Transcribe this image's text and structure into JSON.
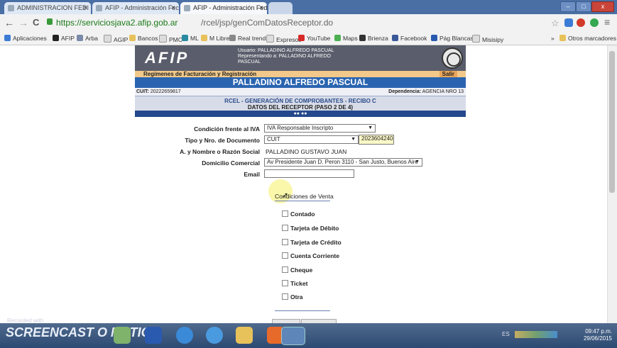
{
  "browser": {
    "tabs": [
      {
        "label": "ADMINISTRACION FEDI"
      },
      {
        "label": "AFIP - Administración Fec"
      },
      {
        "label": "AFIP - Administración Fed"
      }
    ],
    "window_controls": {
      "minimize": "–",
      "maximize": "□",
      "close": "x"
    },
    "nav": {
      "back": "←",
      "forward": "→",
      "reload": "C"
    },
    "url": {
      "domain": "https://serviciosjava2.afip.gob.ar",
      "path": "/rcel/jsp/genComDatosReceptor.do"
    },
    "bookmarks": [
      "Aplicaciones",
      "AFIP",
      "Arba",
      "AGIP",
      "Bancos",
      "PMC",
      "ML",
      "M Libre",
      "Real trends",
      "Expresos",
      "YouTube",
      "Maps",
      "Brienza",
      "Facebook",
      "Pág Blancas",
      "Misisipy"
    ],
    "bookmarks_overflow": "»",
    "other_bookmarks": "Otros marcadores"
  },
  "afip": {
    "logo": "AFIP",
    "usuario": "Usuario: PALLADINO ALFREDO PASCUAL",
    "representando": "Representando a: PALLADINO ALFREDO",
    "pascual": "PASCUAL",
    "regimenes": "Regímenes de Facturación y Registración",
    "salir": "Salir",
    "nombre": "PALLADINO ALFREDO PASCUAL",
    "cuit_label": "CUIT:",
    "cuit_value": "20222659817",
    "dependencia_label": "Dependencia:",
    "dependencia_value": "AGENCIA NRO 13",
    "rcel_title": "RCEL - GENERACIÓN DE COMPROBANTES - RECIBO C",
    "paso_title": "DATOS DEL RECEPTOR (PASO 2 DE 4)",
    "paso_dots": "●● ●●"
  },
  "form": {
    "condicion_label": "Condición frente al IVA",
    "condicion_value": "IVA Responsable Inscripto",
    "tipo_doc_label": "Tipo y Nro. de Documento",
    "tipo_doc_value": "CUIT",
    "nro_doc_value": "20236042406",
    "razon_social_label": "A. y Nombre o Razón Social",
    "razon_social_value": "PALLADINO GUSTAVO JUAN",
    "domicilio_label": "Domicilio Comercial",
    "domicilio_value": "Av Presidente Juan D. Peron 3110 - San Justo, Buenos Aire",
    "email_label": "Email",
    "email_value": "",
    "condiciones_venta_title": "Condiciones de Venta",
    "opciones": [
      "Contado",
      "Tarjeta de Débito",
      "Tarjeta de Crédito",
      "Cuenta Corriente",
      "Cheque",
      "Ticket",
      "Otra"
    ]
  },
  "taskbar": {
    "watermark_small": "Recorded with",
    "watermark": "SCREENCAST O MATIC",
    "lang": "ES",
    "time": "09:47 p.m.",
    "date": "29/06/2015"
  },
  "colors": {
    "tabstrip": "#4a6fa5",
    "afip_header": "#5a5d6b",
    "nombre_bar": "#2a64b0",
    "regimenes_bar": "#f2c98a",
    "step_bar": "#24488c",
    "doc_highlight": "#fbf8c8"
  }
}
